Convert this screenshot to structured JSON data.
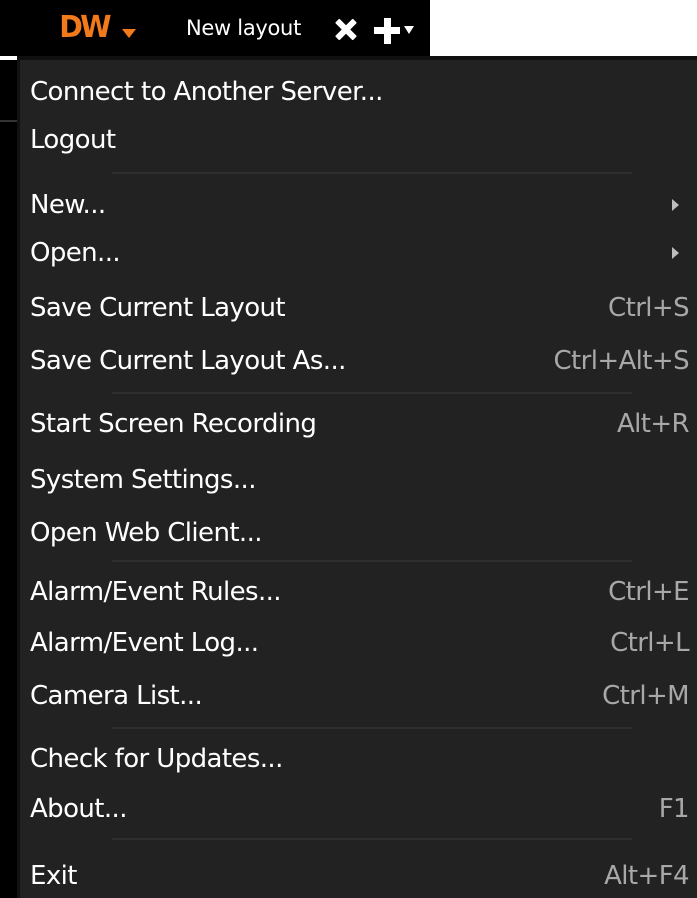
{
  "topbar": {
    "logo_text": "DW",
    "tab_title": "New layout",
    "icons": {
      "logo_caret": "chevron-down-icon",
      "close": "close-icon",
      "add": "plus-icon",
      "add_caret": "chevron-down-icon"
    },
    "colors": {
      "logo": "#f27a1a",
      "bar_background": "#000000"
    }
  },
  "menu": {
    "colors": {
      "background": "#222222",
      "label": "#ffffff",
      "shortcut": "#a8a8a8"
    },
    "items": [
      {
        "label": "Connect to Another Server...",
        "shortcut": ""
      },
      {
        "label": "Logout",
        "shortcut": ""
      },
      {
        "label": "New...",
        "shortcut": "",
        "submenu": true
      },
      {
        "label": "Open...",
        "shortcut": "",
        "submenu": true
      },
      {
        "label": "Save Current Layout",
        "shortcut": "Ctrl+S"
      },
      {
        "label": "Save Current Layout As...",
        "shortcut": "Ctrl+Alt+S"
      },
      {
        "label": "Start Screen Recording",
        "shortcut": "Alt+R"
      },
      {
        "label": "System Settings...",
        "shortcut": ""
      },
      {
        "label": "Open Web Client...",
        "shortcut": ""
      },
      {
        "label": "Alarm/Event Rules...",
        "shortcut": "Ctrl+E"
      },
      {
        "label": "Alarm/Event Log...",
        "shortcut": "Ctrl+L"
      },
      {
        "label": "Camera List...",
        "shortcut": "Ctrl+M"
      },
      {
        "label": "Check for Updates...",
        "shortcut": ""
      },
      {
        "label": "About...",
        "shortcut": "F1"
      },
      {
        "label": "Exit",
        "shortcut": "Alt+F4"
      }
    ]
  }
}
